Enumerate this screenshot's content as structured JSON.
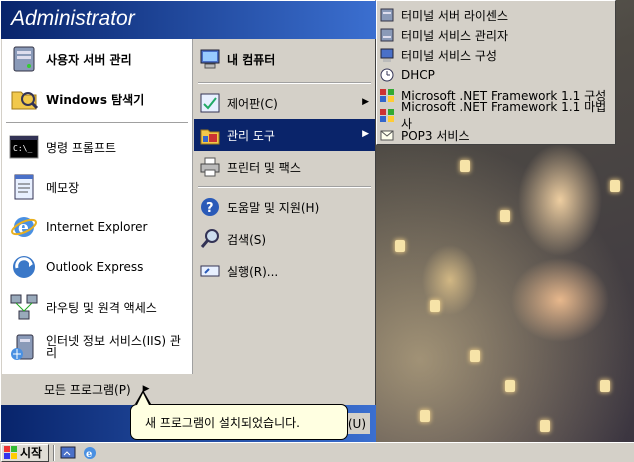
{
  "start_menu": {
    "user_name": "Administrator",
    "pinned": [
      {
        "label": "사용자 서버 관리",
        "icon": "server-management-icon"
      },
      {
        "label": "Windows 탐색기",
        "icon": "explorer-icon"
      }
    ],
    "recent": [
      {
        "label": "명령 프롬프트",
        "icon": "command-prompt-icon"
      },
      {
        "label": "메모장",
        "icon": "notepad-icon"
      },
      {
        "label": "Internet Explorer",
        "icon": "internet-explorer-icon"
      },
      {
        "label": "Outlook Express",
        "icon": "outlook-express-icon"
      },
      {
        "label": "라우팅 및 원격 액세스",
        "icon": "routing-remote-access-icon"
      },
      {
        "label": "인터넷 정보 서비스(IIS) 관리",
        "icon": "iis-manager-icon"
      }
    ],
    "all_programs": "모든 프로그램(P)",
    "right": {
      "my_computer": "내 컴퓨터",
      "items": [
        {
          "label": "제어판(C)",
          "icon": "control-panel-icon",
          "arrow": true
        },
        {
          "label": "관리 도구",
          "icon": "admin-tools-icon",
          "arrow": true
        },
        {
          "label": "프린터 및 팩스",
          "icon": "printers-faxes-icon",
          "arrow": false
        }
      ],
      "items2": [
        {
          "label": "도움말 및 지원(H)",
          "icon": "help-icon"
        },
        {
          "label": "검색(S)",
          "icon": "search-icon"
        },
        {
          "label": "실행(R)...",
          "icon": "run-icon"
        }
      ]
    },
    "footer": {
      "logoff_label": "료(U)"
    }
  },
  "submenu": {
    "items": [
      "터미널 서버 라이센스",
      "터미널 서비스 관리자",
      "터미널 서비스 구성",
      "DHCP",
      "Microsoft .NET Framework 1.1 구성",
      "Microsoft .NET Framework 1.1 마법사",
      "POP3 서비스"
    ]
  },
  "balloon": {
    "text": "새 프로그램이 설치되었습니다."
  },
  "taskbar": {
    "start_label": "시작"
  },
  "colors": {
    "selection": "#0a246a",
    "header_start": "#08246b",
    "header_end": "#3b6fd0",
    "menu_bg": "#d4d0c8"
  }
}
